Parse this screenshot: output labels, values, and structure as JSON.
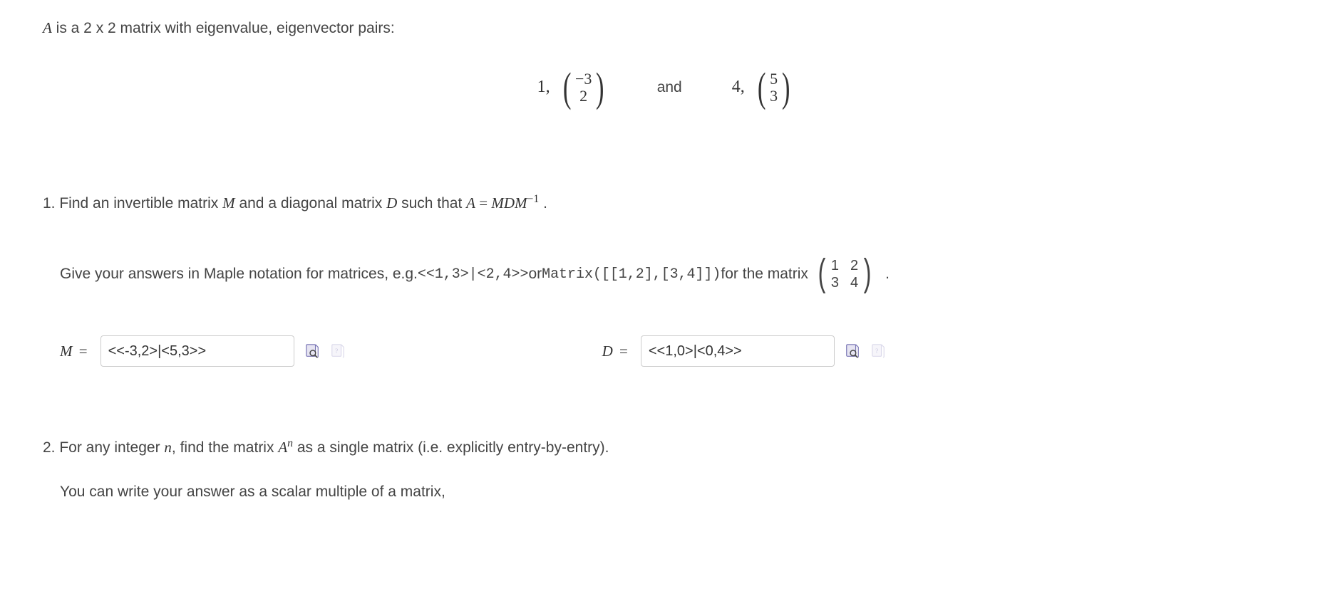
{
  "intro": {
    "A": "A",
    "is_a": " is a 2 x 2 matrix with eigenvalue, eigenvector pairs:"
  },
  "display": {
    "pair1_eig": "1,",
    "vec1_top": "−3",
    "vec1_bot": "2",
    "and": "and",
    "pair2_eig": "4,",
    "vec2_top": "5",
    "vec2_bot": "3"
  },
  "q1": {
    "prefix": "1. Find an invertible matrix ",
    "M": "M",
    "mid1": " and a diagonal matrix ",
    "D": "D",
    "mid2": " such that ",
    "A": "A",
    "eq": " = ",
    "Mconcat": "M",
    "Dconcat": "D",
    "Mconcat2": "M",
    "neg1": "−1",
    "dot": " ."
  },
  "instr": {
    "pre": "Give your answers in Maple notation for matrices, e.g.   ",
    "code1": "<<1,3>|<2,4>>",
    "or": " or ",
    "code2": "Matrix([[1,2],[3,4]])",
    "for": " for  the matrix ",
    "m11": "1",
    "m12": "2",
    "m21": "3",
    "m22": "4",
    "period": "."
  },
  "answers": {
    "M_label_sym": "M",
    "eq": " = ",
    "M_value": "<<-3,2>|<5,3>>",
    "D_label_sym": "D",
    "D_value": "<<1,0>|<0,4>>"
  },
  "q2": {
    "prefix": "2. For any integer ",
    "n": "n",
    "mid": ", find the matrix ",
    "A": "A",
    "exp_n": "n",
    "tail": "    as a single matrix (i.e. explicitly entry-by-entry)."
  },
  "footnote": "You can write your answer as a scalar multiple of a matrix,"
}
